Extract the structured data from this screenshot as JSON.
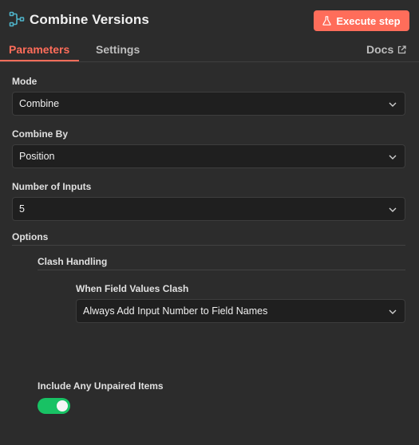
{
  "header": {
    "title": "Combine Versions",
    "execute_label": "Execute step"
  },
  "tabs": {
    "parameters": "Parameters",
    "settings": "Settings",
    "docs": "Docs"
  },
  "fields": {
    "mode": {
      "label": "Mode",
      "value": "Combine"
    },
    "combine_by": {
      "label": "Combine By",
      "value": "Position"
    },
    "number_of_inputs": {
      "label": "Number of Inputs",
      "value": "5"
    },
    "options": {
      "label": "Options"
    },
    "clash_handling": {
      "label": "Clash Handling"
    },
    "when_field_values_clash": {
      "label": "When Field Values Clash",
      "value": "Always Add Input Number to Field Names"
    },
    "include_unpaired": {
      "label": "Include Any Unpaired Items",
      "enabled": true
    }
  },
  "colors": {
    "accent": "#ff6d5a",
    "toggle_on": "#18c264",
    "background": "#2c2c2c",
    "input_bg": "#1f1f1f",
    "icon_teal": "#4fb3c9"
  },
  "icons": {
    "node": "merge-node-icon",
    "execute": "flask-icon",
    "docs": "external-link-icon",
    "dropdown": "chevron-down-icon"
  }
}
